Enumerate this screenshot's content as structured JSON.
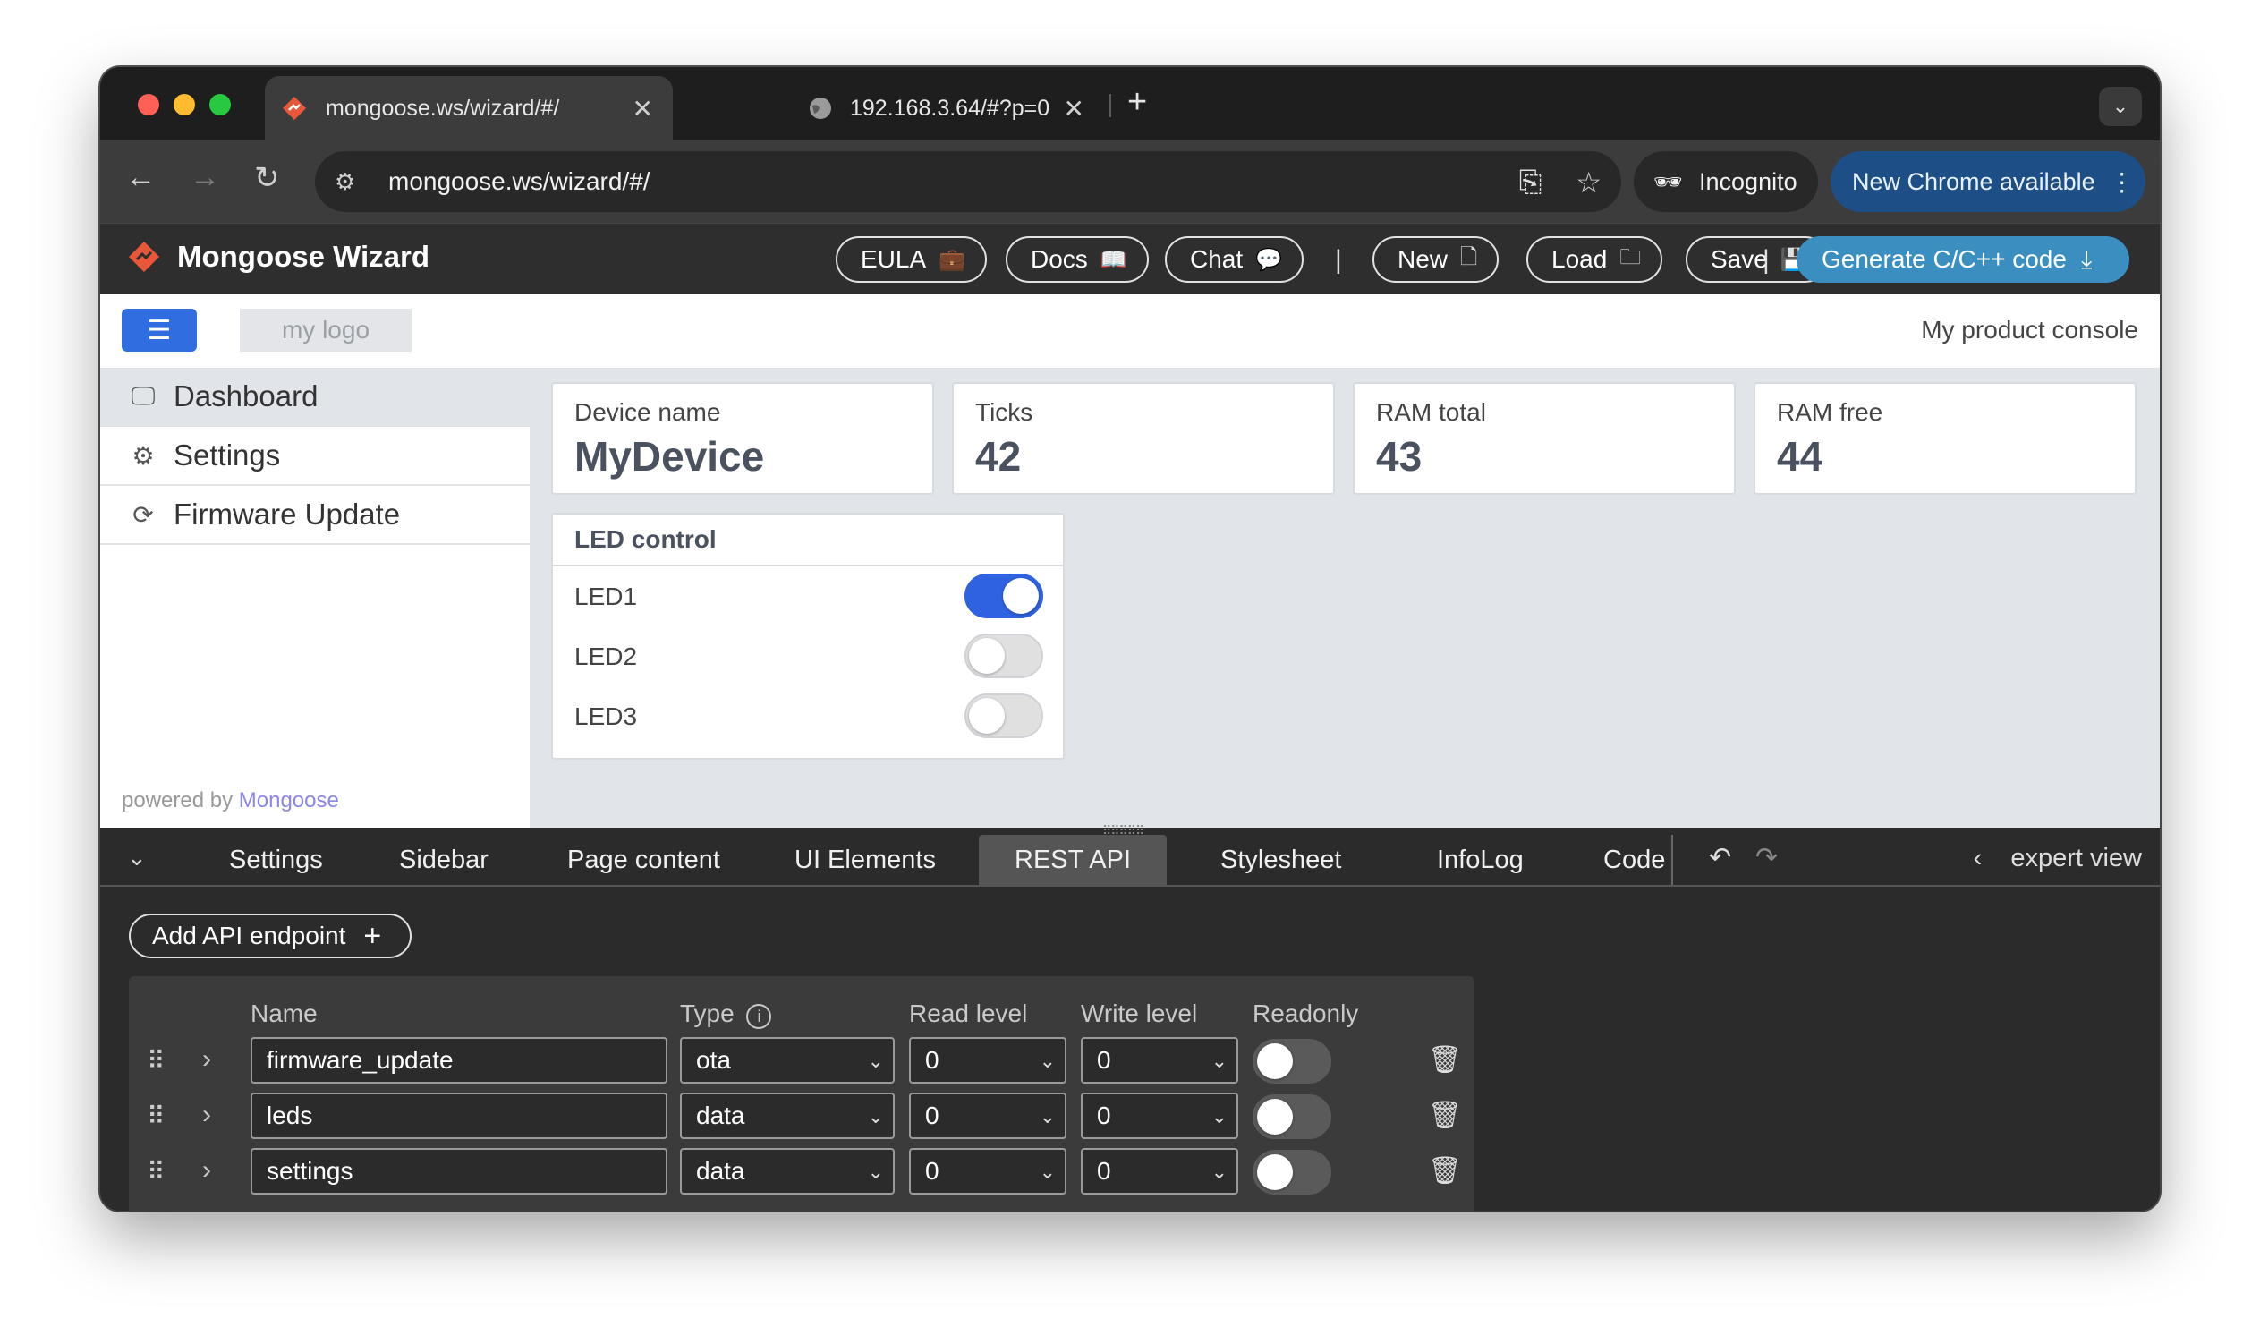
{
  "browser": {
    "tabs": [
      {
        "title": "mongoose.ws/wizard/#/",
        "active": true
      },
      {
        "title": "192.168.3.64/#?p=0",
        "active": false
      }
    ],
    "url": "mongoose.ws/wizard/#/",
    "incognito_label": "Incognito",
    "update_label": "New Chrome available"
  },
  "app": {
    "title": "Mongoose Wizard",
    "buttons": {
      "eula": "EULA",
      "docs": "Docs",
      "chat": "Chat",
      "new": "New",
      "load": "Load",
      "save": "Save",
      "generate": "Generate C/C++ code"
    },
    "separator": "|"
  },
  "preview": {
    "logo_placeholder": "my logo",
    "product_console": "My product console",
    "sidebar": [
      {
        "label": "Dashboard",
        "icon": "monitor-icon",
        "active": true
      },
      {
        "label": "Settings",
        "icon": "gear-icon",
        "active": false
      },
      {
        "label": "Firmware Update",
        "icon": "refresh-icon",
        "active": false
      }
    ],
    "powered_by": "powered by",
    "powered_link": "Mongoose",
    "stats": [
      {
        "label": "Device name",
        "value": "MyDevice"
      },
      {
        "label": "Ticks",
        "value": "42"
      },
      {
        "label": "RAM total",
        "value": "43"
      },
      {
        "label": "RAM free",
        "value": "44"
      }
    ],
    "led_control": {
      "title": "LED control",
      "leds": [
        {
          "label": "LED1",
          "on": true
        },
        {
          "label": "LED2",
          "on": false
        },
        {
          "label": "LED3",
          "on": false
        }
      ]
    }
  },
  "wizard": {
    "tabs": [
      "Settings",
      "Sidebar",
      "Page content",
      "UI Elements",
      "REST API",
      "Stylesheet",
      "InfoLog",
      "Code"
    ],
    "active_tab": "REST API",
    "expert_view": "expert view",
    "add_endpoint": "Add API endpoint",
    "columns": {
      "name": "Name",
      "type": "Type",
      "read_level": "Read level",
      "write_level": "Write level",
      "readonly": "Readonly"
    },
    "endpoints": [
      {
        "name": "firmware_update",
        "type": "ota",
        "read_level": "0",
        "write_level": "0",
        "readonly": false
      },
      {
        "name": "leds",
        "type": "data",
        "read_level": "0",
        "write_level": "0",
        "readonly": false
      },
      {
        "name": "settings",
        "type": "data",
        "read_level": "0",
        "write_level": "0",
        "readonly": false
      }
    ]
  },
  "colors": {
    "accent": "#2f62e0",
    "generate_button": "#3a8ec0",
    "brand": "#e8573a",
    "update_pill": "#1d4f86"
  }
}
